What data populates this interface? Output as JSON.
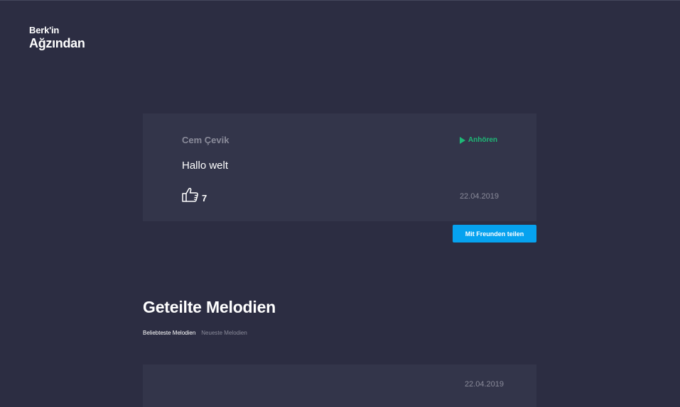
{
  "logo": {
    "line1": "Berk'in",
    "line2": "Ağzından"
  },
  "post": {
    "author": "Cem Çevik",
    "listen_label": "Anhören",
    "message": "Hallo welt",
    "likes": "7",
    "date": "22.04.2019"
  },
  "share_button_label": "Mit Freunden teilen",
  "section": {
    "title": "Geteilte Melodien",
    "tabs": [
      {
        "label": "Beliebteste Melodien",
        "active": true
      },
      {
        "label": "Neueste Melodien",
        "active": false
      }
    ]
  },
  "second_post": {
    "date": "22.04.2019"
  },
  "colors": {
    "background": "#2c2d42",
    "card": "#33354a",
    "accent_green": "#1fb877",
    "accent_blue": "#06a2ef",
    "muted_text": "#8a8b9a"
  },
  "icons": {
    "listen": "play-icon",
    "likes": "thumbs-up-icon"
  }
}
